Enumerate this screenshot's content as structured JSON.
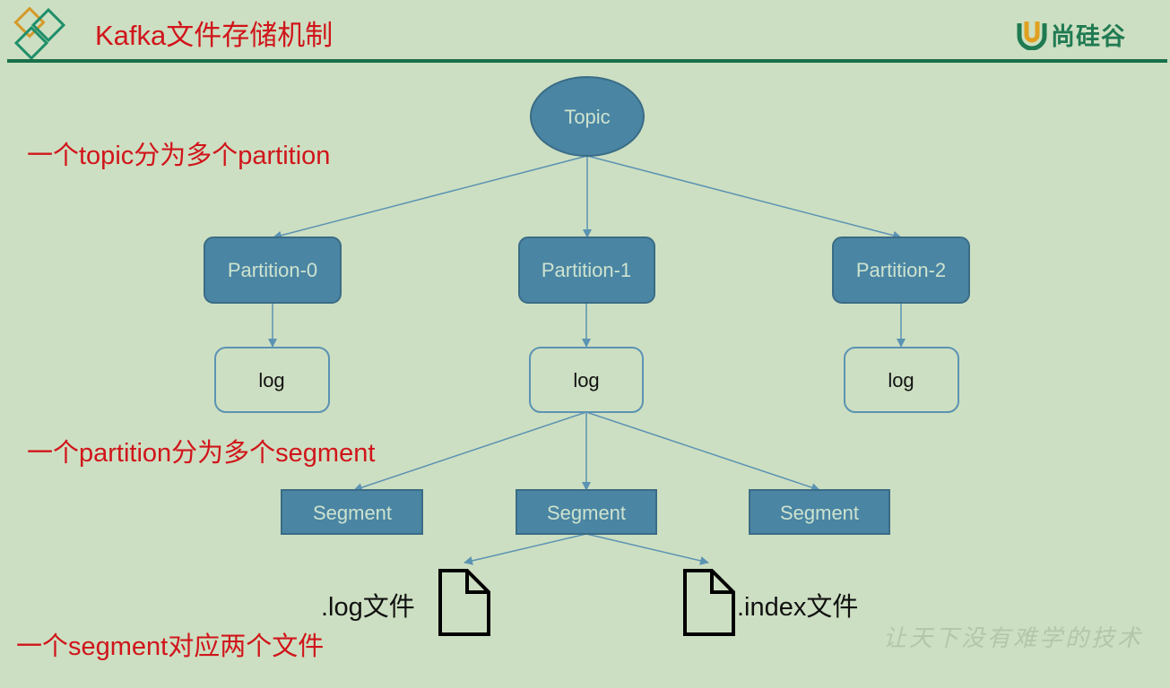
{
  "header": {
    "title": "Kafka文件存储机制",
    "brand_text": "尚硅谷",
    "brand_icon_letter": "U",
    "logo_icon": "diamond-logo-icon"
  },
  "colors": {
    "background": "#cddfc2",
    "accent_red": "#d0151b",
    "rule_green": "#17704a",
    "node_fill": "#4a85a3",
    "node_border": "#3a6c86",
    "edge": "#5b93b3"
  },
  "notes": {
    "topic_partition": "一个topic分为多个partition",
    "partition_segment": "一个partition分为多个segment",
    "segment_files": "一个segment对应两个文件"
  },
  "diagram": {
    "topic": {
      "label": "Topic"
    },
    "partitions": [
      {
        "label": "Partition-0",
        "log_label": "log"
      },
      {
        "label": "Partition-1",
        "log_label": "log"
      },
      {
        "label": "Partition-2",
        "log_label": "log"
      }
    ],
    "segments": [
      {
        "label": "Segment"
      },
      {
        "label": "Segment"
      },
      {
        "label": "Segment"
      }
    ],
    "files": [
      {
        "label": ".log文件",
        "icon": "file-icon"
      },
      {
        "label": ".index文件",
        "icon": "file-icon"
      }
    ]
  },
  "footer": {
    "slogan": "让天下没有难学的技术"
  }
}
